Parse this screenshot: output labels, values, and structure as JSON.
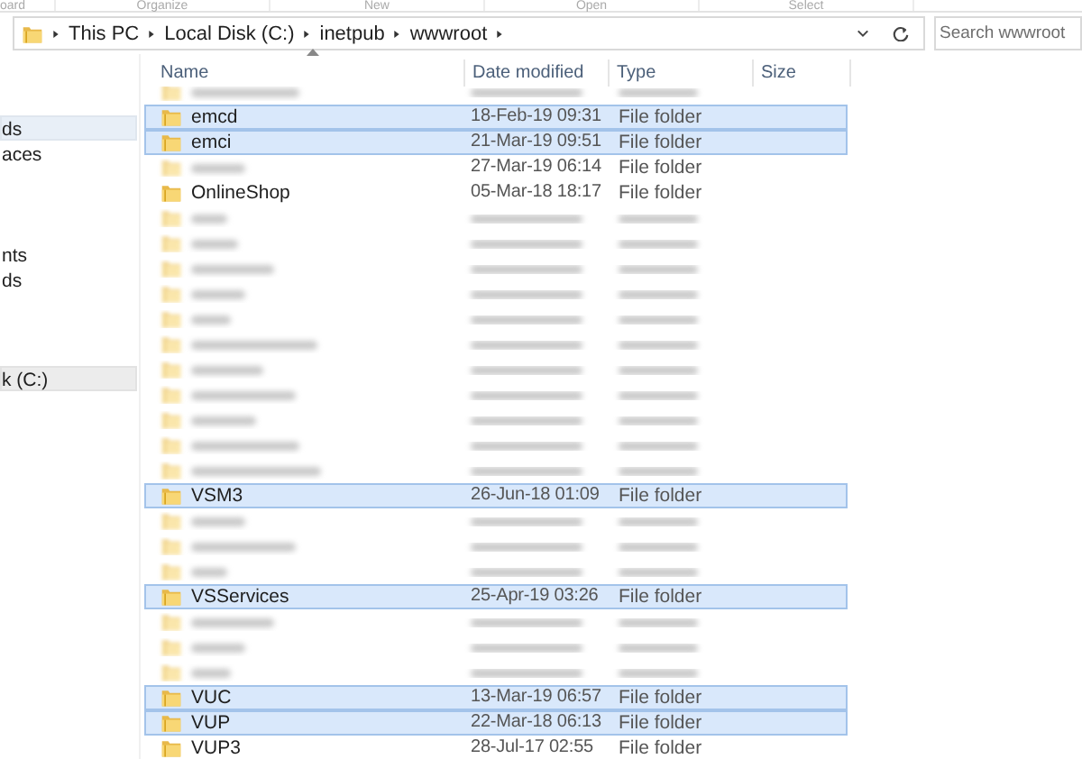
{
  "ribbon_groups": [
    "oard",
    "Organize",
    "New",
    "Open",
    "Select"
  ],
  "address_bar": {
    "path": [
      "This PC",
      "Local Disk (C:)",
      "inetpub",
      "wwwroot"
    ]
  },
  "search": {
    "placeholder": "Search wwwroot"
  },
  "nav_pane": {
    "items": [
      {
        "label": "ds",
        "selected": true
      },
      {
        "label": "aces",
        "selected": false
      },
      {
        "label": "nts",
        "selected": false
      },
      {
        "label": "ds",
        "selected": false
      },
      {
        "label": "k (C:)",
        "selected": true
      }
    ]
  },
  "table": {
    "columns": [
      "Name",
      "Date modified",
      "Type",
      "Size"
    ],
    "rows": [
      {
        "selected": false
      },
      {
        "name": "emcd",
        "date": "18-Feb-19 09:31",
        "type": "File folder",
        "selected": true
      },
      {
        "name": "emci",
        "date": "21-Mar-19 09:51",
        "type": "File folder",
        "selected": true
      },
      {
        "date": "27-Mar-19 06:14",
        "type": "File folder",
        "selected": false
      },
      {
        "name": "OnlineShop",
        "date": "05-Mar-18 18:17",
        "type": "File folder",
        "selected": false
      },
      {
        "selected": false
      },
      {
        "selected": false
      },
      {
        "selected": false
      },
      {
        "selected": false
      },
      {
        "selected": false
      },
      {
        "selected": false
      },
      {
        "selected": false
      },
      {
        "selected": false
      },
      {
        "selected": false
      },
      {
        "selected": false
      },
      {
        "selected": false
      },
      {
        "name": "VSM3",
        "date": "26-Jun-18 01:09",
        "type": "File folder",
        "selected": true
      },
      {
        "selected": false
      },
      {
        "selected": false
      },
      {
        "selected": false
      },
      {
        "name": "VSServices",
        "date": "25-Apr-19 03:26",
        "type": "File folder",
        "selected": true
      },
      {
        "selected": false
      },
      {
        "selected": false
      },
      {
        "selected": false
      },
      {
        "name": "VUC",
        "date": "13-Mar-19 06:57",
        "type": "File folder",
        "selected": true
      },
      {
        "name": "VUP",
        "date": "22-Mar-18 06:13",
        "type": "File folder",
        "selected": true
      },
      {
        "name": "VUP3",
        "date": "28-Jul-17 02:55",
        "type": "File folder",
        "selected": false
      }
    ]
  }
}
